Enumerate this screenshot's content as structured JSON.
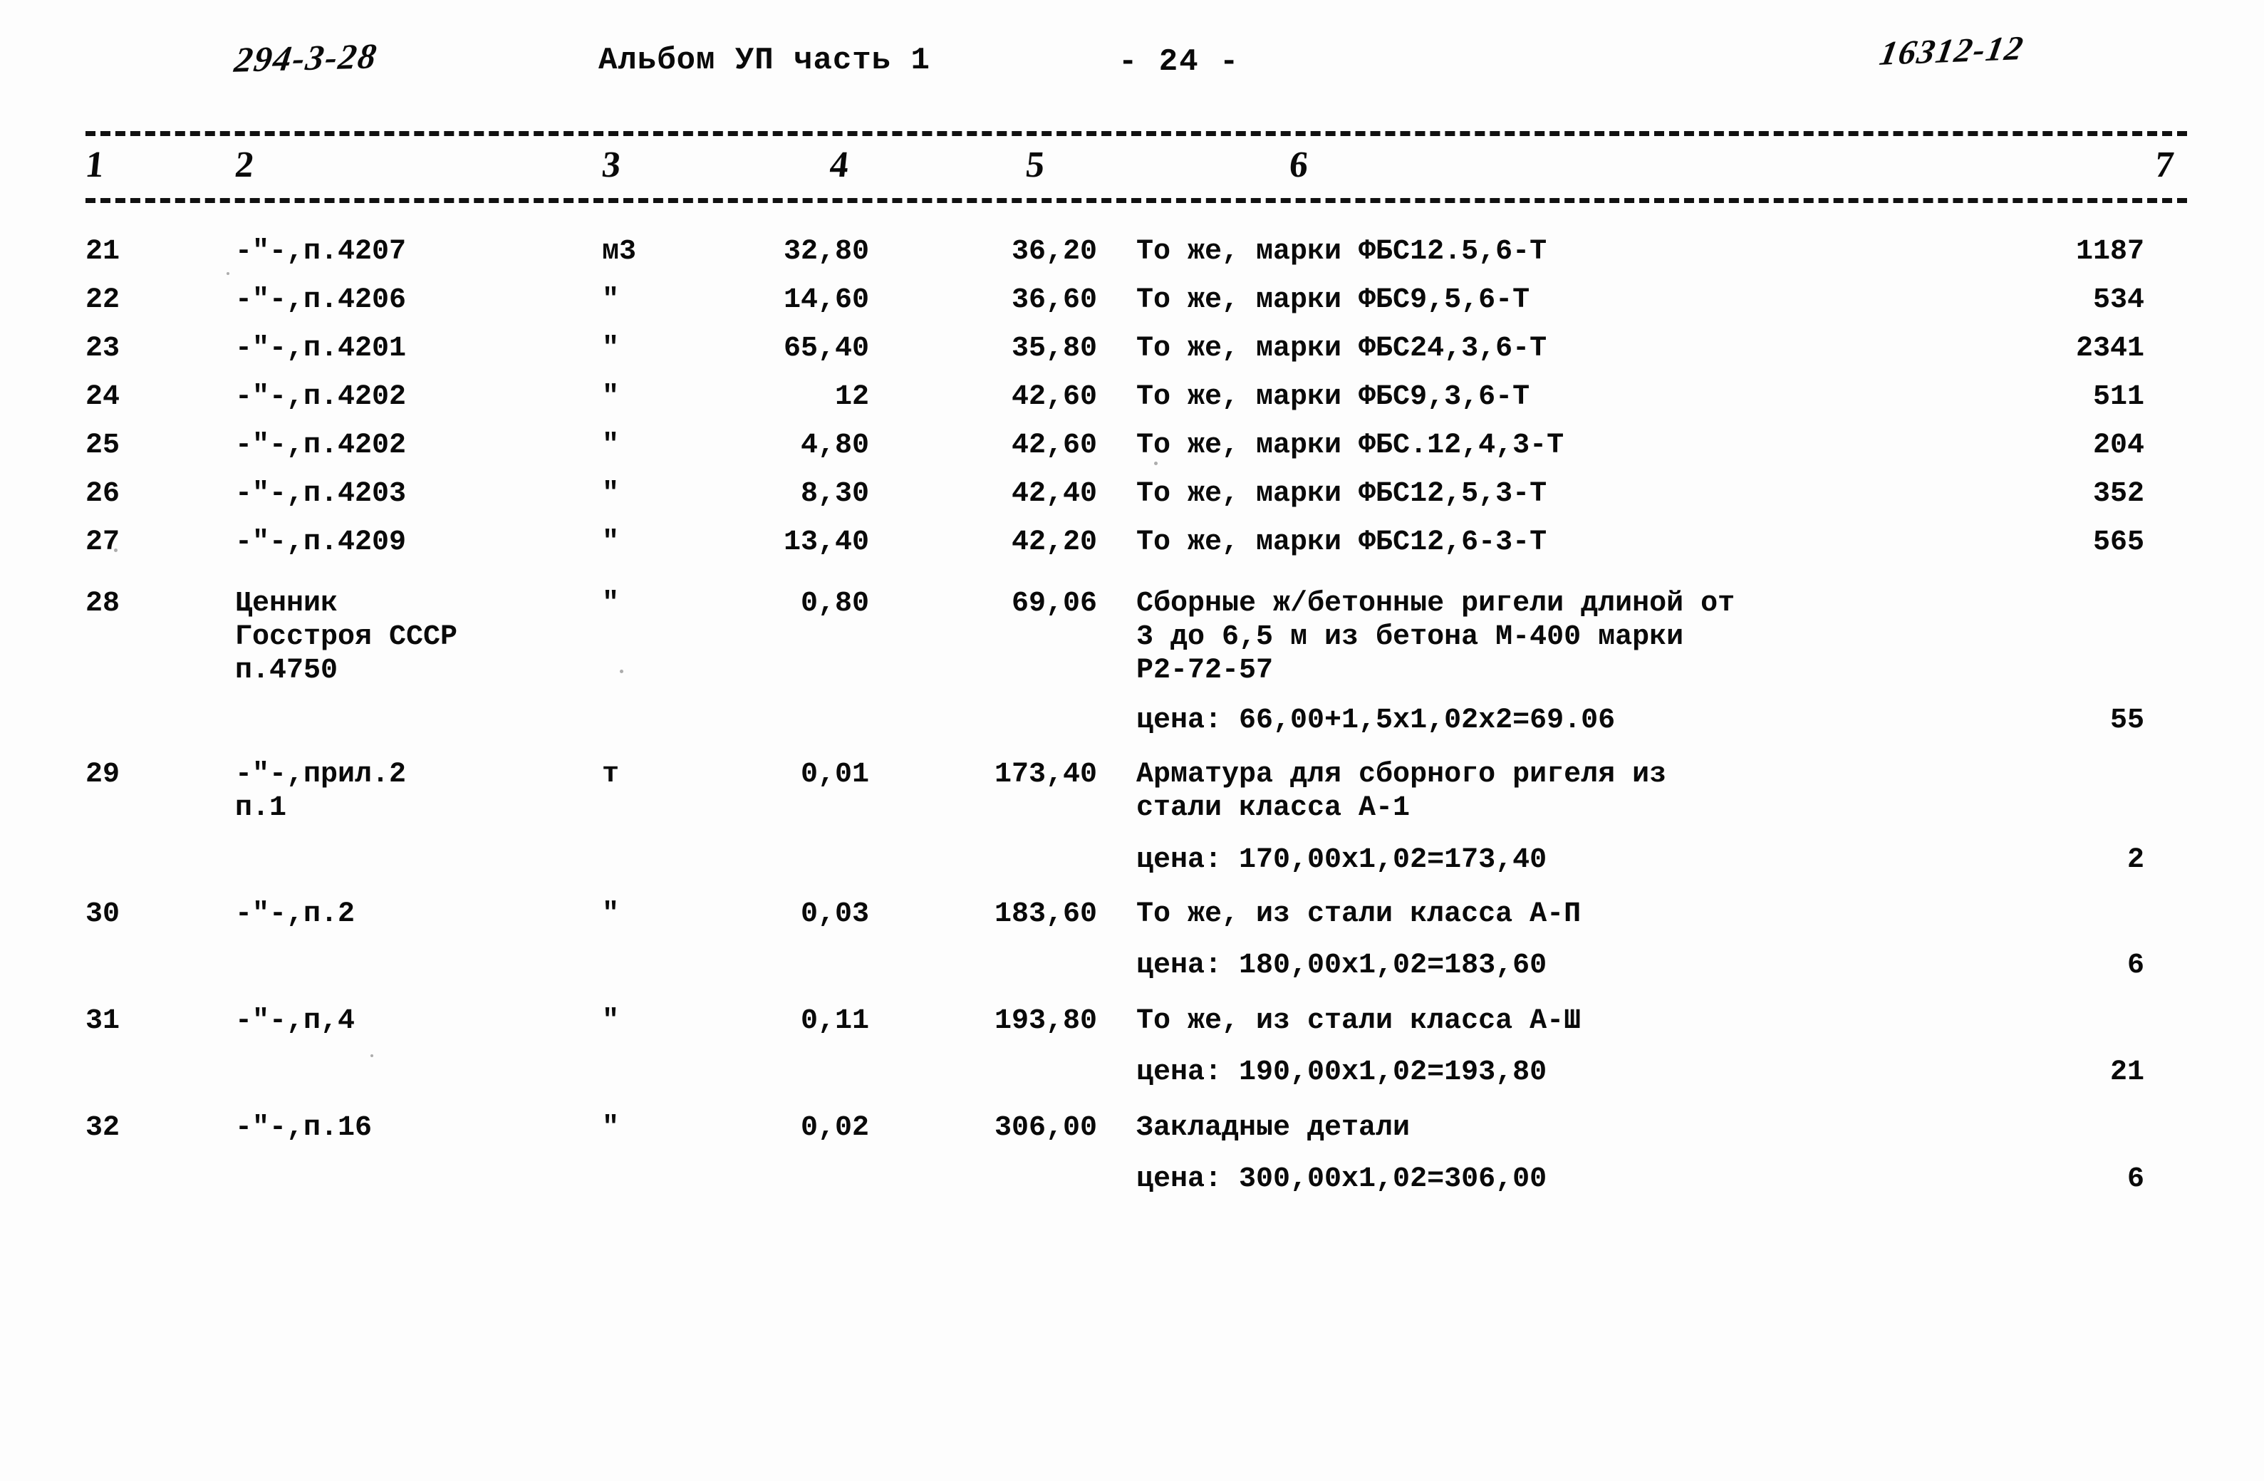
{
  "header": {
    "project_code": "294-3-28",
    "album": "Альбом УП часть 1",
    "page_marker": "- 24 -",
    "archive_stamp": "16312-12"
  },
  "column_numbers": [
    "1",
    "2",
    "3",
    "4",
    "5",
    "6",
    "7"
  ],
  "rows": [
    {
      "num": "21",
      "ref": "-\"-,п.4207",
      "unit": "м3",
      "qty": "32,80",
      "price": "36,20",
      "desc": "То же, марки ФБС12.5,6-Т",
      "total": "1187"
    },
    {
      "num": "22",
      "ref": "-\"-,п.4206",
      "unit": "\"",
      "qty": "14,60",
      "price": "36,60",
      "desc": "То же, марки ФБС9,5,6-Т",
      "total": "534"
    },
    {
      "num": "23",
      "ref": "-\"-,п.4201",
      "unit": "\"",
      "qty": "65,40",
      "price": "35,80",
      "desc": "То же, марки ФБС24,3,6-Т",
      "total": "2341"
    },
    {
      "num": "24",
      "ref": "-\"-,п.4202",
      "unit": "\"",
      "qty": "12",
      "price": "42,60",
      "desc": "То же, марки ФБС9,3,6-Т",
      "total": "511"
    },
    {
      "num": "25",
      "ref": "-\"-,п.4202",
      "unit": "\"",
      "qty": "4,80",
      "price": "42,60",
      "desc": "То же, марки ФБС.12,4,3-Т",
      "total": "204"
    },
    {
      "num": "26",
      "ref": "-\"-,п.4203",
      "unit": "\"",
      "qty": "8,30",
      "price": "42,40",
      "desc": "То же, марки ФБС12,5,3-Т",
      "total": "352"
    },
    {
      "num": "27",
      "ref": "-\"-,п.4209",
      "unit": "\"",
      "qty": "13,40",
      "price": "42,20",
      "desc": "То же, марки ФБС12,6-3-Т",
      "total": "565"
    },
    {
      "num": "28",
      "ref": "Ценник\nГосстроя СССР\nп.4750",
      "unit": "\"",
      "qty": "0,80",
      "price": "69,06",
      "desc": "Сборные ж/бетонные ригели длиной от\n3 до 6,5 м из бетона М-400 марки\nР2-72-57",
      "price_note": "цена: 66,00+1,5x1,02x2=69.06",
      "total": "55"
    },
    {
      "num": "29",
      "ref": "-\"-,прил.2\nп.1",
      "unit": "т",
      "qty": "0,01",
      "price": "173,40",
      "desc": "Арматура для сборного ригеля из\nстали класса А-1",
      "price_note": "цена: 170,00x1,02=173,40",
      "total": "2"
    },
    {
      "num": "30",
      "ref": "-\"-,п.2",
      "unit": "\"",
      "qty": "0,03",
      "price": "183,60",
      "desc": "То же, из стали класса А-П",
      "price_note": "цена: 180,00x1,02=183,60",
      "total": "6"
    },
    {
      "num": "31",
      "ref": "-\"-,п,4",
      "unit": "\"",
      "qty": "0,11",
      "price": "193,80",
      "desc": "То же, из стали класса А-Ш",
      "price_note": "цена: 190,00x1,02=193,80",
      "total": "21"
    },
    {
      "num": "32",
      "ref": "-\"-,п.16",
      "unit": "\"",
      "qty": "0,02",
      "price": "306,00",
      "desc": "Закладные детали",
      "price_note": "цена: 300,00x1,02=306,00",
      "total": "6"
    }
  ]
}
